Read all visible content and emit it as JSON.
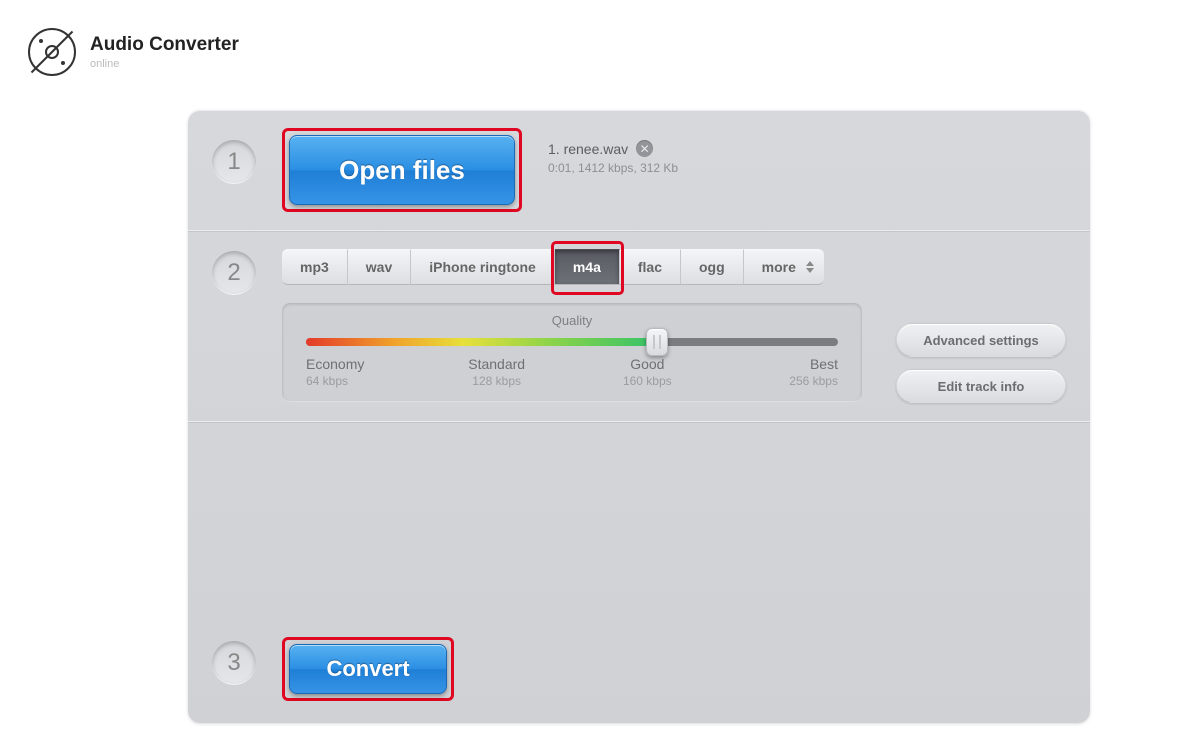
{
  "header": {
    "title": "Audio Converter",
    "subtitle": "online"
  },
  "step1": {
    "number": "1",
    "open_label": "Open files",
    "file_label": "1. renee.wav",
    "file_detail": "0:01, 1412 kbps, 312 Kb"
  },
  "step2": {
    "number": "2",
    "formats": {
      "mp3": "mp3",
      "wav": "wav",
      "iphone": "iPhone ringtone",
      "m4a": "m4a",
      "flac": "flac",
      "ogg": "ogg",
      "more": "more"
    },
    "quality_label": "Quality",
    "ticks": {
      "economy": {
        "name": "Economy",
        "rate": "64 kbps"
      },
      "standard": {
        "name": "Standard",
        "rate": "128 kbps"
      },
      "good": {
        "name": "Good",
        "rate": "160 kbps"
      },
      "best": {
        "name": "Best",
        "rate": "256 kbps"
      }
    },
    "advanced_label": "Advanced settings",
    "edit_label": "Edit track info"
  },
  "step3": {
    "number": "3",
    "convert_label": "Convert"
  }
}
